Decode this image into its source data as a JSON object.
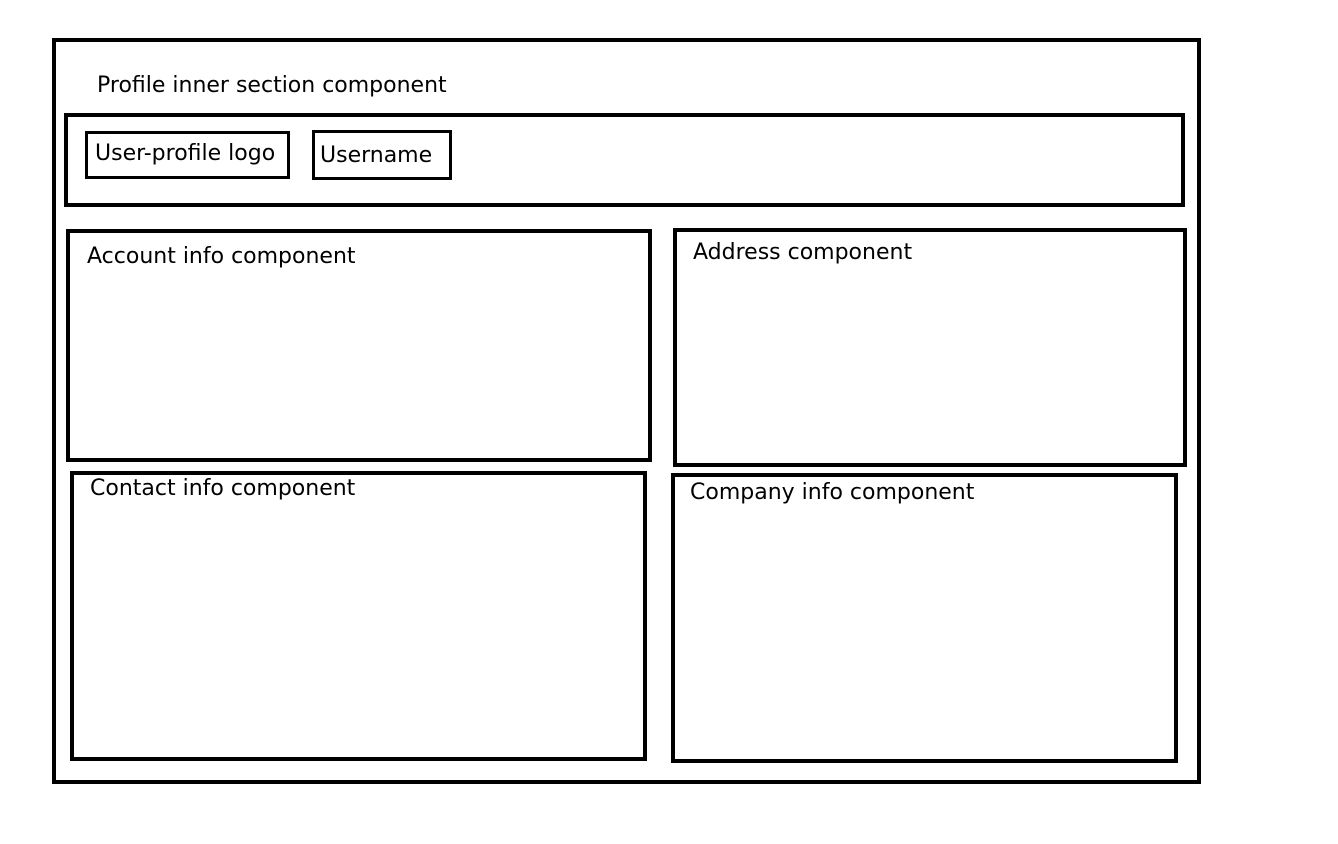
{
  "profile_section": {
    "title": "Profile inner section component",
    "header": {
      "logo_label": "User-profile logo",
      "username_label": "Username"
    },
    "components": {
      "account_info": "Account info component",
      "address": "Address component",
      "contact_info": "Contact info component",
      "company_info": "Company info component"
    }
  }
}
